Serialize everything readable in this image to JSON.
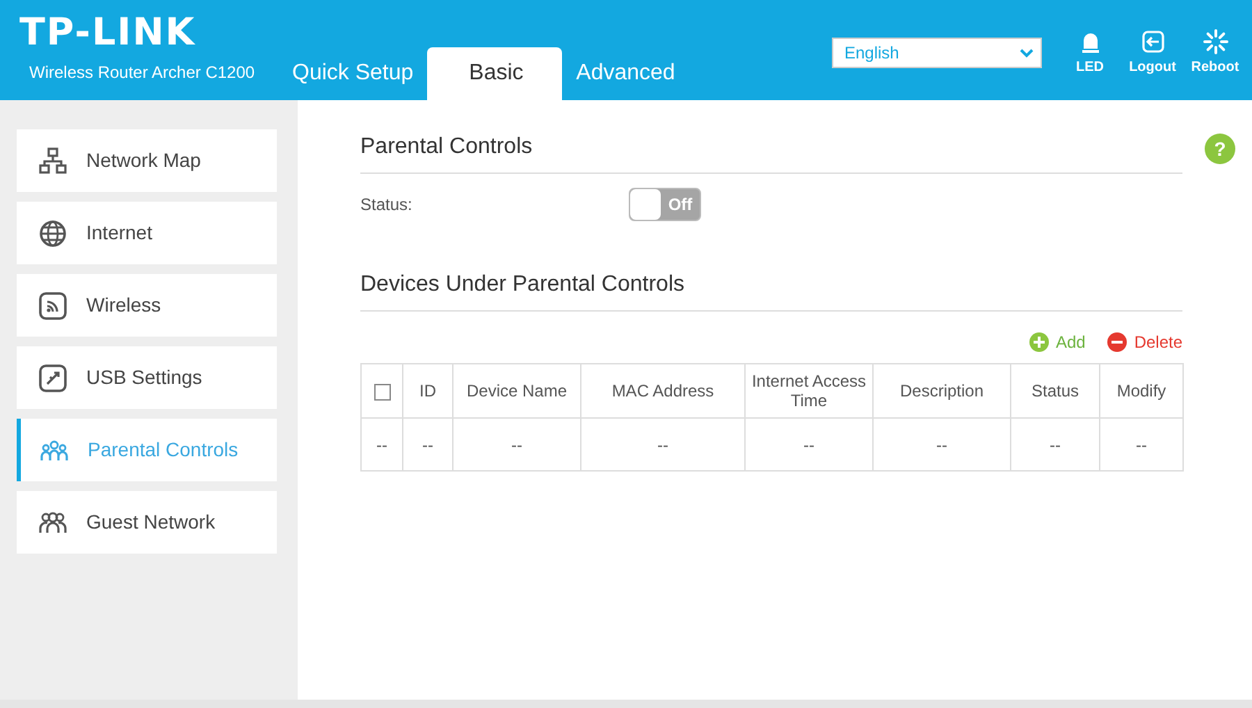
{
  "header": {
    "logo": "TP-LINK",
    "model": "Wireless Router Archer C1200",
    "tabs": [
      {
        "label": "Quick Setup",
        "selected": false
      },
      {
        "label": "Basic",
        "selected": true
      },
      {
        "label": "Advanced",
        "selected": false
      }
    ],
    "language": {
      "value": "English"
    },
    "actions": [
      {
        "kind": "led",
        "label": "LED"
      },
      {
        "kind": "logout",
        "label": "Logout"
      },
      {
        "kind": "reboot",
        "label": "Reboot"
      }
    ]
  },
  "sidebar": {
    "items": [
      {
        "kind": "network",
        "label": "Network Map",
        "selected": false
      },
      {
        "kind": "internet",
        "label": "Internet",
        "selected": false
      },
      {
        "kind": "wireless",
        "label": "Wireless",
        "selected": false
      },
      {
        "kind": "usb",
        "label": "USB Settings",
        "selected": false
      },
      {
        "kind": "parental",
        "label": "Parental Controls",
        "selected": true
      },
      {
        "kind": "guest",
        "label": "Guest Network",
        "selected": false
      }
    ]
  },
  "help": "?",
  "parental_controls": {
    "title": "Parental Controls",
    "status_label": "Status:",
    "toggle": {
      "on": false,
      "label": "Off"
    }
  },
  "devices": {
    "title": "Devices Under Parental Controls",
    "add": "Add",
    "delete": "Delete",
    "table": {
      "select_all": {
        "checked": false
      },
      "columns": [
        "",
        "ID",
        "Device Name",
        "MAC Address",
        "Internet Access Time",
        "Description",
        "Status",
        "Modify"
      ],
      "rows": [
        [
          "--",
          "--",
          "--",
          "--",
          "--",
          "--",
          "--",
          "--"
        ]
      ]
    }
  }
}
